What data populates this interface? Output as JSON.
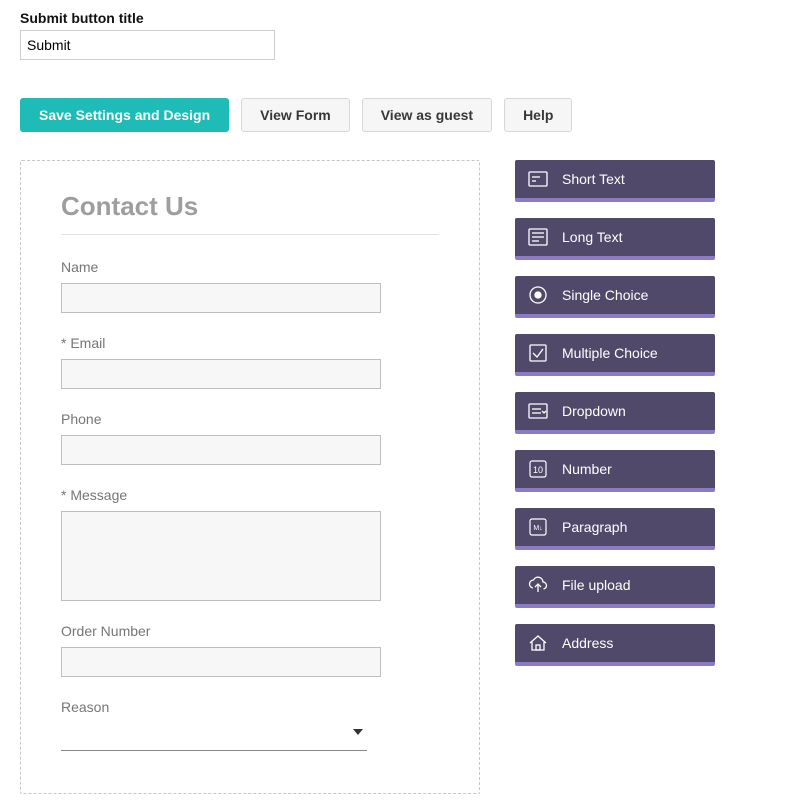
{
  "top": {
    "label": "Submit button title",
    "value": "Submit"
  },
  "toolbar": {
    "save": "Save Settings and Design",
    "view_form": "View Form",
    "view_guest": "View as guest",
    "help": "Help"
  },
  "form": {
    "title": "Contact Us",
    "fields": {
      "name": "Name",
      "email": "* Email",
      "phone": "Phone",
      "message": "* Message",
      "order_number": "Order Number",
      "reason": "Reason"
    }
  },
  "palette": {
    "short_text": "Short Text",
    "long_text": "Long Text",
    "single_choice": "Single Choice",
    "multiple_choice": "Multiple Choice",
    "dropdown": "Dropdown",
    "number": "Number",
    "paragraph": "Paragraph",
    "file_upload": "File upload",
    "address": "Address"
  }
}
